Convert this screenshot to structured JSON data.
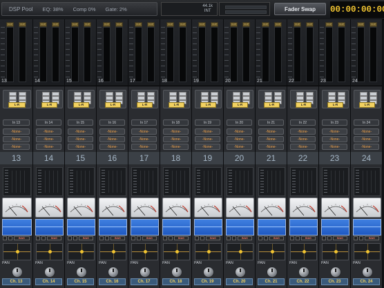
{
  "topbar": {
    "dsp_title": "DSP Pool",
    "eq": "EQ: 38%",
    "comp": "Comp 0%",
    "gate": "Gate: 2%",
    "sample_rate": "44.1k",
    "clock_source": "INT",
    "fader_swap": "Fader Swap",
    "timecode": "00:00:00:00"
  },
  "colors": {
    "accent_yellow": "#f2c531",
    "eq_blue": "#2b6ad4",
    "channel_label_bg": "#3a5a7a",
    "insert_orange": "#f0a24a"
  },
  "common": {
    "clip_label": "CLIP",
    "output_route": "L-R",
    "insert_none": "-None-",
    "pan_label": "PAN",
    "flag_label": "B/AG"
  },
  "channels": [
    {
      "num": "13",
      "input": "In 13",
      "name": "Ch. 13"
    },
    {
      "num": "14",
      "input": "In 14",
      "name": "Ch. 14"
    },
    {
      "num": "15",
      "input": "In 15",
      "name": "Ch. 15"
    },
    {
      "num": "16",
      "input": "In 16",
      "name": "Ch. 16"
    },
    {
      "num": "17",
      "input": "In 17",
      "name": "Ch. 17"
    },
    {
      "num": "18",
      "input": "In 18",
      "name": "Ch. 18"
    },
    {
      "num": "19",
      "input": "In 19",
      "name": "Ch. 19"
    },
    {
      "num": "20",
      "input": "In 20",
      "name": "Ch. 20"
    },
    {
      "num": "21",
      "input": "In 21",
      "name": "Ch. 21"
    },
    {
      "num": "22",
      "input": "In 22",
      "name": "Ch. 22"
    },
    {
      "num": "23",
      "input": "In 23",
      "name": "Ch. 23"
    },
    {
      "num": "24",
      "input": "In 24",
      "name": "Ch. 24"
    }
  ]
}
